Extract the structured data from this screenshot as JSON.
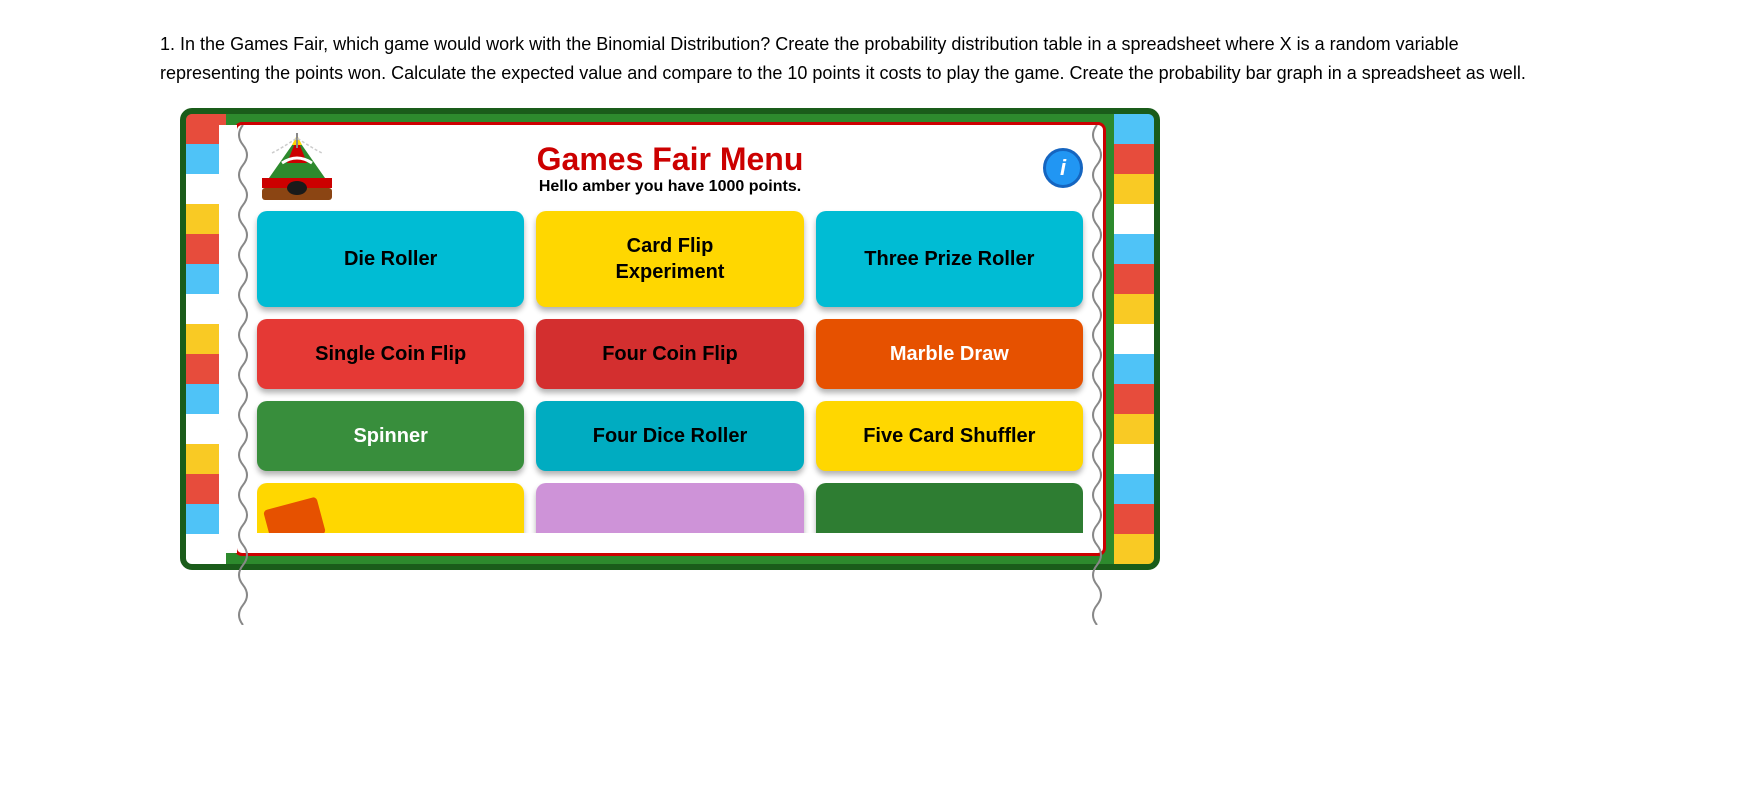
{
  "question": {
    "number": "1.",
    "text": "In the Games Fair, which game would work with the Binomial Distribution?  Create the probability distribution table in a spreadsheet where X is a random variable representing the points won. Calculate the expected value and compare to the 10 points it costs to play the game.  Create the probability bar graph in a spreadsheet as well."
  },
  "gamesFair": {
    "title": "Games Fair Menu",
    "subtitle": "Hello amber you have 1000 points.",
    "infoButton": "i",
    "buttons": [
      {
        "label": "Die Roller",
        "color": "cyan",
        "row": 1,
        "col": 1
      },
      {
        "label": "Card Flip\nExperiment",
        "color": "yellow",
        "row": 1,
        "col": 2
      },
      {
        "label": "Three Prize Roller",
        "color": "cyan",
        "row": 1,
        "col": 3
      },
      {
        "label": "Single Coin Flip",
        "color": "red",
        "row": 2,
        "col": 1
      },
      {
        "label": "Four Coin Flip",
        "color": "red",
        "row": 2,
        "col": 2
      },
      {
        "label": "Marble Draw",
        "color": "orange",
        "row": 2,
        "col": 3
      },
      {
        "label": "Spinner",
        "color": "green",
        "row": 3,
        "col": 1
      },
      {
        "label": "Four Dice Roller",
        "color": "cyan2",
        "row": 3,
        "col": 2
      },
      {
        "label": "Five Card Shuffler",
        "color": "yellow2",
        "row": 3,
        "col": 3
      }
    ],
    "bottomButtons": [
      {
        "label": "",
        "color": "yellow3"
      },
      {
        "label": "",
        "color": "purple"
      },
      {
        "label": "",
        "color": "green2"
      }
    ]
  }
}
